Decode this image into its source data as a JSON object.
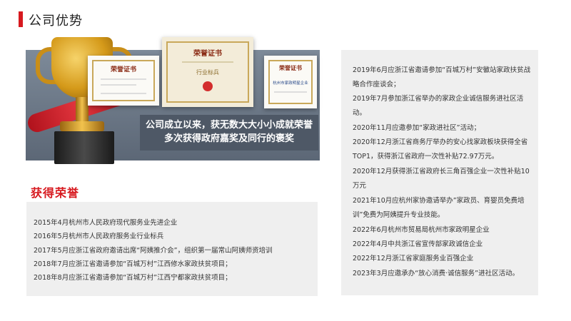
{
  "header": {
    "title": "公司优势",
    "accent_color": "#d7191f"
  },
  "hero": {
    "caption_line1": "公司成立以来，获无数大大小小成就荣誉",
    "caption_line2": "多次获得政府嘉奖及同行的褒奖",
    "cert1_title": "荣誉证书",
    "cert2_title": "荣誉证书",
    "cert2_tag": "行业标兵",
    "cert3_title": "荣誉证书",
    "cert3_tag": "杭州市家政明星企业"
  },
  "honors": {
    "heading": "获得荣誉",
    "left_items": [
      "2015年4月杭州市人民政府现代服务业先进企业",
      "2016年5月杭州市人民政府服务业行业标兵",
      "2017年5月应浙江省政府邀请出席“阿姨推介会”，组织第一届常山阿姨师资培训",
      "2018年7月应浙江省邀请参加“百城万村”江西修水家政扶贫项目；",
      "2018年8月应浙江省邀请参加“百城万村”江西宁都家政扶贫项目；"
    ],
    "right_items": [
      "2019年6月应浙江省邀请参加“百城万村”安徽站家政扶贫战略合作座谈会；",
      "2019年7月参加浙江省举办的家政企业诚信服务进社区活动。",
      "2020年11月应邀参加“家政进社区”活动；",
      "2020年12月浙江省商务厅举办的安心找家政板块获得全省TOP1，获得浙江省政府一次性补贴72.97万元。",
      "2020年12月获得浙江省政府长三角百强企业一次性补贴10万元",
      "2021年10月应杭州家协邀请举办”家政员、育婴员免费培训”免费为阿姨提升专业技能。",
      "2022年6月杭州市贸易局杭州市家政明星企业",
      "2022年4月中共浙江省宣传部家政诚信企业",
      "2022年12月浙江省家庭服务业百强企业",
      "2023年3月应邀承办“放心消费·诚信服务”进社区活动。"
    ]
  }
}
